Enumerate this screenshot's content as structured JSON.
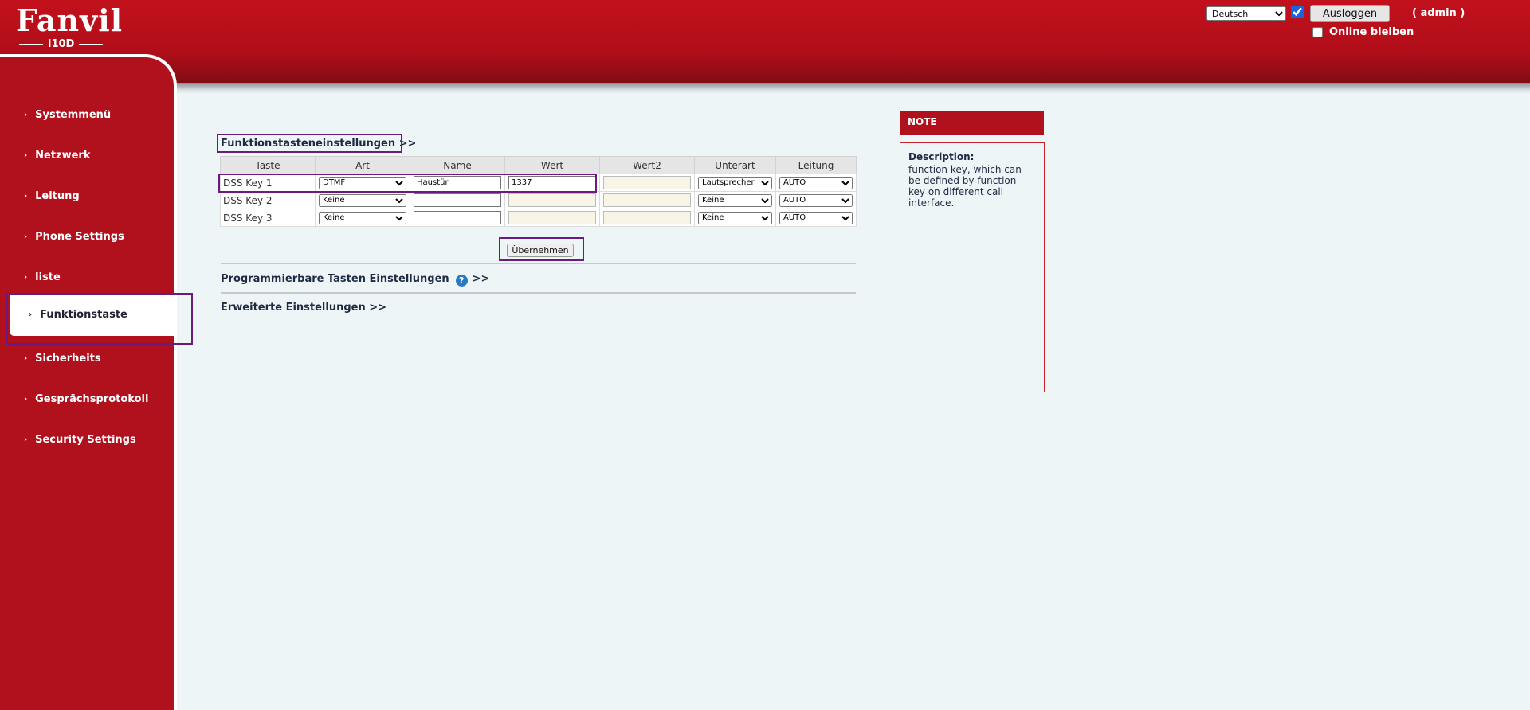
{
  "header": {
    "logo_text": "Fanvil",
    "model": "i10D",
    "language_options": [
      "Deutsch"
    ],
    "language_selected": "Deutsch",
    "logout_label": "Ausloggen",
    "user_label": "( admin )",
    "stay_online_label": "Online bleiben",
    "brand_color": "#b0111d"
  },
  "sidebar": {
    "items": [
      {
        "label": "Systemmenü"
      },
      {
        "label": "Netzwerk"
      },
      {
        "label": "Leitung"
      },
      {
        "label": "Phone Settings"
      },
      {
        "label": "liste"
      },
      {
        "label": "Funktionstaste",
        "active": true
      },
      {
        "label": "Sicherheits"
      },
      {
        "label": "Gesprächsprotokoll"
      },
      {
        "label": "Security Settings"
      }
    ]
  },
  "main": {
    "section1_title": "Funktionstasteneinstellungen >>",
    "table": {
      "headers": [
        "Taste",
        "Art",
        "Name",
        "Wert",
        "Wert2",
        "Unterart",
        "Leitung"
      ],
      "rows": [
        {
          "key": "DSS Key 1",
          "art": "DTMF",
          "name": "Haustür",
          "wert": "1337",
          "wert2": "",
          "unterart": "Lautsprecher",
          "leitung": "AUTO"
        },
        {
          "key": "DSS Key 2",
          "art": "Keine",
          "name": "",
          "wert": "",
          "wert2": "",
          "unterart": "Keine",
          "leitung": "AUTO"
        },
        {
          "key": "DSS Key 3",
          "art": "Keine",
          "name": "",
          "wert": "",
          "wert2": "",
          "unterart": "Keine",
          "leitung": "AUTO"
        }
      ]
    },
    "apply_label": "Übernehmen",
    "section2_title": "Programmierbare Tasten Einstellungen",
    "section2_suffix": ">>",
    "help_icon": "?",
    "section3_title": "Erweiterte Einstellungen >>"
  },
  "note": {
    "header": "NOTE",
    "title": "Description:",
    "text": "function key, which can be defined by function key on different call interface."
  }
}
